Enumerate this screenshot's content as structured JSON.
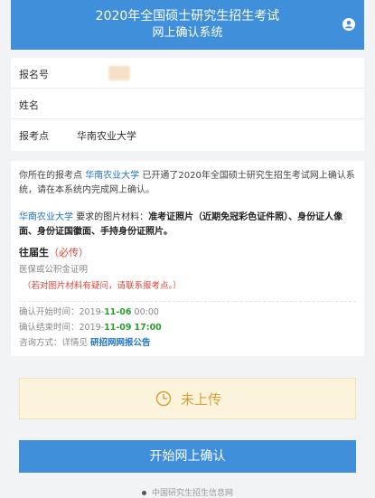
{
  "header": {
    "title_line1": "2020年全国硕士研究生招生考试",
    "title_line2": "网上确认系统"
  },
  "info": {
    "rows": [
      {
        "label": "报名号",
        "value": ""
      },
      {
        "label": "姓名",
        "value": ""
      },
      {
        "label": "报考点",
        "value": "华南农业大学"
      }
    ]
  },
  "notice": {
    "p1_prefix": "你所在的报考点",
    "school": "华南农业大学",
    "p1_suffix": "已开通了2020年全国硕士研究生招生考试网上确认系统，请在本系统内完成网上确认。",
    "p2_suffix": "要求的图片材料：",
    "p2_bold": "准考证照片（近期免冠彩色证件照）、身份证人像面、身份证国徽面、手持身份证照片。",
    "graduate_label": "往届生",
    "required": "（必传）",
    "graduate_item": "医保或公积金证明",
    "question_note": "（若对图片材料有疑问，请联系报考点。）",
    "start_label": "确认开始时间：",
    "start_year": "2019-",
    "start_date": "11-06",
    "start_time": " 00:00",
    "end_label": "确认结束时间：",
    "end_year": "2019-",
    "end_date": "11-09",
    "end_time": "17:00",
    "contact_label": "咨询方式：详情见",
    "contact_link": "研招网网报公告"
  },
  "status": {
    "text": "未上传",
    "color": "#d9a23a"
  },
  "confirm_button": "开始网上确认",
  "footer": "中国研究生招生信息网",
  "colors": {
    "primary": "#3f8fda",
    "link": "#1f73c6",
    "required": "#e0463c",
    "date": "#2f9a2f"
  }
}
